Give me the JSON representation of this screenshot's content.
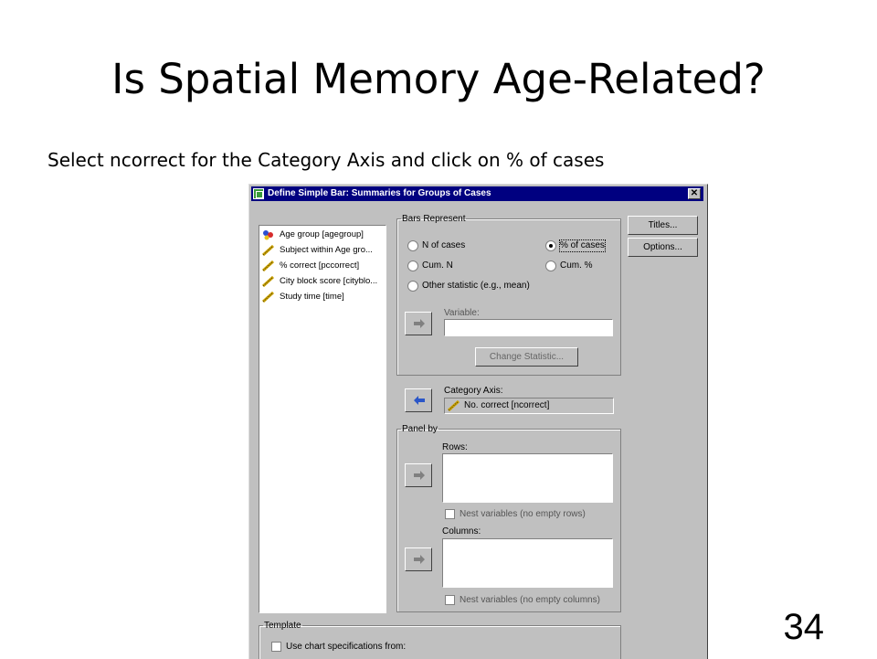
{
  "slide": {
    "title": "Is Spatial Memory Age-Related?",
    "subtitle": "Select ncorrect for the Category Axis and  click on % of cases",
    "page_number": "34"
  },
  "dialog": {
    "title": "Define Simple Bar: Summaries for Groups of Cases",
    "close_label": "✕",
    "variables": [
      {
        "label": "Age group [agegroup]",
        "icon": "nominal-variable-icon"
      },
      {
        "label": "Subject within Age gro...",
        "icon": "scale-variable-icon"
      },
      {
        "label": "% correct [pccorrect]",
        "icon": "scale-variable-icon"
      },
      {
        "label": "City block score [cityblo...",
        "icon": "scale-variable-icon"
      },
      {
        "label": "Study time [time]",
        "icon": "scale-variable-icon"
      }
    ],
    "bars_represent": {
      "legend": "Bars Represent",
      "options": [
        {
          "label": "N of cases",
          "selected": false
        },
        {
          "label": "% of cases",
          "selected": true
        },
        {
          "label": "Cum. N",
          "selected": false
        },
        {
          "label": "Cum. %",
          "selected": false
        },
        {
          "label": "Other statistic (e.g., mean)",
          "selected": false
        }
      ],
      "variable_label": "Variable:",
      "change_statistic_label": "Change Statistic..."
    },
    "category_axis": {
      "label": "Category Axis:",
      "value": "No. correct [ncorrect]"
    },
    "panel_by": {
      "legend": "Panel by",
      "rows_label": "Rows:",
      "nest_rows_label": "Nest variables (no empty rows)",
      "columns_label": "Columns:",
      "nest_columns_label": "Nest variables (no empty columns)"
    },
    "template": {
      "legend": "Template",
      "use_chart_label": "Use chart specifications from:"
    },
    "side_buttons": {
      "titles_label": "Titles...",
      "options_label": "Options..."
    },
    "colors": {
      "titlebar": "#000080",
      "face": "#c0c0c0",
      "selected_field": "#c0c0c0"
    }
  }
}
